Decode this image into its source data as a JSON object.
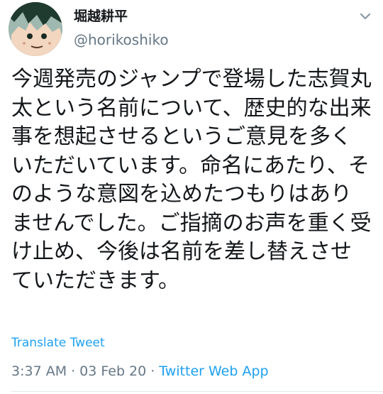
{
  "author": {
    "display_name": "堀越耕平",
    "handle": "@horikoshiko"
  },
  "tweet": {
    "lines": [
      "今週発売のジャンプで登場した志賀丸",
      "太という名前について、歴史的な出来",
      "事を想起させるというご意見を多く",
      "いただいています。命名にあたり、そ",
      "のような意図を込めたつもりはあり",
      "ませんでした。ご指摘のお声を重く受",
      "け止め、今後は名前を差し替えさせ",
      "ていただきます。"
    ],
    "translate_label": "Translate Tweet",
    "time": "3:37 AM",
    "date": "03 Feb 20",
    "source": "Twitter Web App",
    "separator": "·"
  },
  "icons": {
    "menu": "chevron-down-icon"
  },
  "colors": {
    "link": "#1da1f2",
    "muted": "#657786",
    "text": "#14171a"
  }
}
